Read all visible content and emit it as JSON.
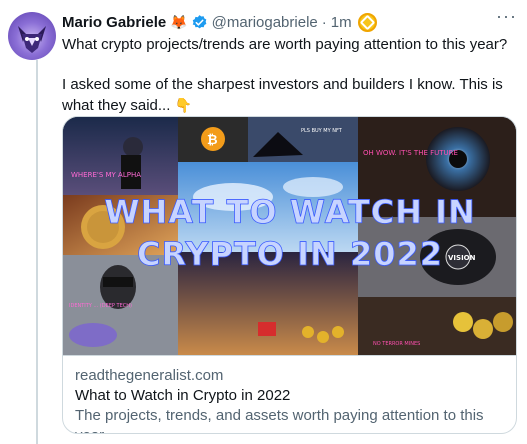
{
  "author": {
    "name": "Mario Gabriele",
    "emoji": "🦊",
    "handle": "@mariogabriele",
    "separator": "·",
    "time": "1m"
  },
  "tweet": {
    "line1": "What crypto projects/trends are worth paying attention to this year?",
    "line2": "I asked some of the sharpest investors and builders I know. This is what they said...",
    "emoji": "👇"
  },
  "card": {
    "image_headline_line1": "WHAT TO WATCH IN",
    "image_headline_line2": "CRYPTO IN 2022",
    "collage_texts": {
      "tl": "WHERE'S MY ALPHA",
      "tr_small": "PLS BUY MY NFT",
      "tr": "OH WOW. IT'S THE FUTURE",
      "vision": "VISION",
      "left_low": "IDENTITY ... (DEEP TECH)",
      "bottom_right": "NO TERROR MINES"
    },
    "domain": "readthegeneralist.com",
    "title": "What to Watch in Crypto in 2022",
    "description": "The projects, trends, and assets worth paying attention to this year."
  },
  "colors": {
    "accent": "#1d9bf0",
    "verified": "#1d9bf0",
    "muted": "#536471",
    "headline": "#c7d4ff"
  },
  "icons": {
    "verified": "verified-badge-icon",
    "coin": "coin-badge-icon",
    "more": "more-icon"
  }
}
